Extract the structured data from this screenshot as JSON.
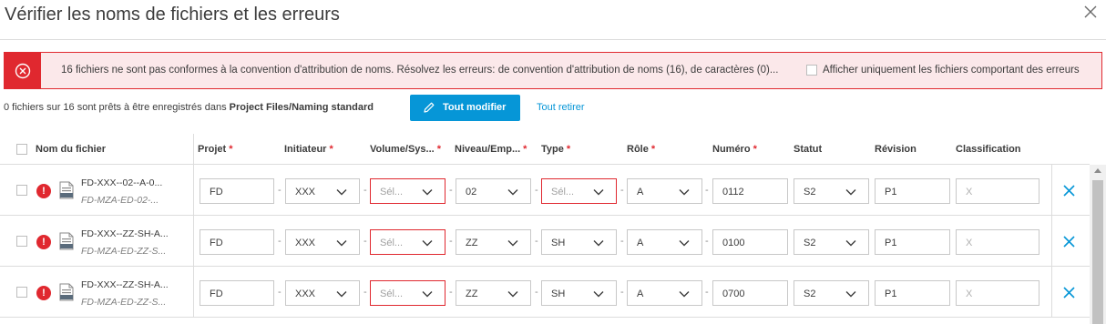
{
  "dialog": {
    "title": "Vérifier les noms de fichiers et les erreurs"
  },
  "error_banner": {
    "message": "16 fichiers ne sont pas conformes à la convention d'attribution de noms. Résolvez les erreurs: de convention d'attribution de noms (16), de caractères (0)...",
    "filter_label": "Afficher uniquement les fichiers comportant des erreurs",
    "color": "#e0282f"
  },
  "status": {
    "prefix": "0 fichiers sur 16 sont prêts à être enregistrés dans ",
    "folder": "Project Files/Naming standard"
  },
  "toolbar": {
    "edit_all_label": "Tout modifier",
    "remove_all_label": "Tout retirer",
    "accent": "#0696d7"
  },
  "columns": {
    "filename": "Nom du fichier",
    "projet": "Projet",
    "initiateur": "Initiateur",
    "volume": "Volume/Sys...",
    "niveau": "Niveau/Emp...",
    "type": "Type",
    "role": "Rôle",
    "numero": "Numéro",
    "statut": "Statut",
    "revision": "Révision",
    "classification": "Classification",
    "required_marker": "*"
  },
  "rows": [
    {
      "name": "FD-XXX--02--A-0...",
      "sub": "FD-MZA-ED-02-...",
      "projet": "FD",
      "initiateur": "XXX",
      "volume": "Sél...",
      "niveau": "02",
      "type": "Sél...",
      "role": "A",
      "numero": "0112",
      "statut": "S2",
      "revision": "P1",
      "classification": "X"
    },
    {
      "name": "FD-XXX--ZZ-SH-A...",
      "sub": "FD-MZA-ED-ZZ-S...",
      "projet": "FD",
      "initiateur": "XXX",
      "volume": "Sél...",
      "niveau": "ZZ",
      "type": "SH",
      "role": "A",
      "numero": "0100",
      "statut": "S2",
      "revision": "P1",
      "classification": "X"
    },
    {
      "name": "FD-XXX--ZZ-SH-A...",
      "sub": "FD-MZA-ED-ZZ-S...",
      "projet": "FD",
      "initiateur": "XXX",
      "volume": "Sél...",
      "niveau": "ZZ",
      "type": "SH",
      "role": "A",
      "numero": "0700",
      "statut": "S2",
      "revision": "P1",
      "classification": "X"
    }
  ],
  "row_error_glyph": "!",
  "separator": "-"
}
